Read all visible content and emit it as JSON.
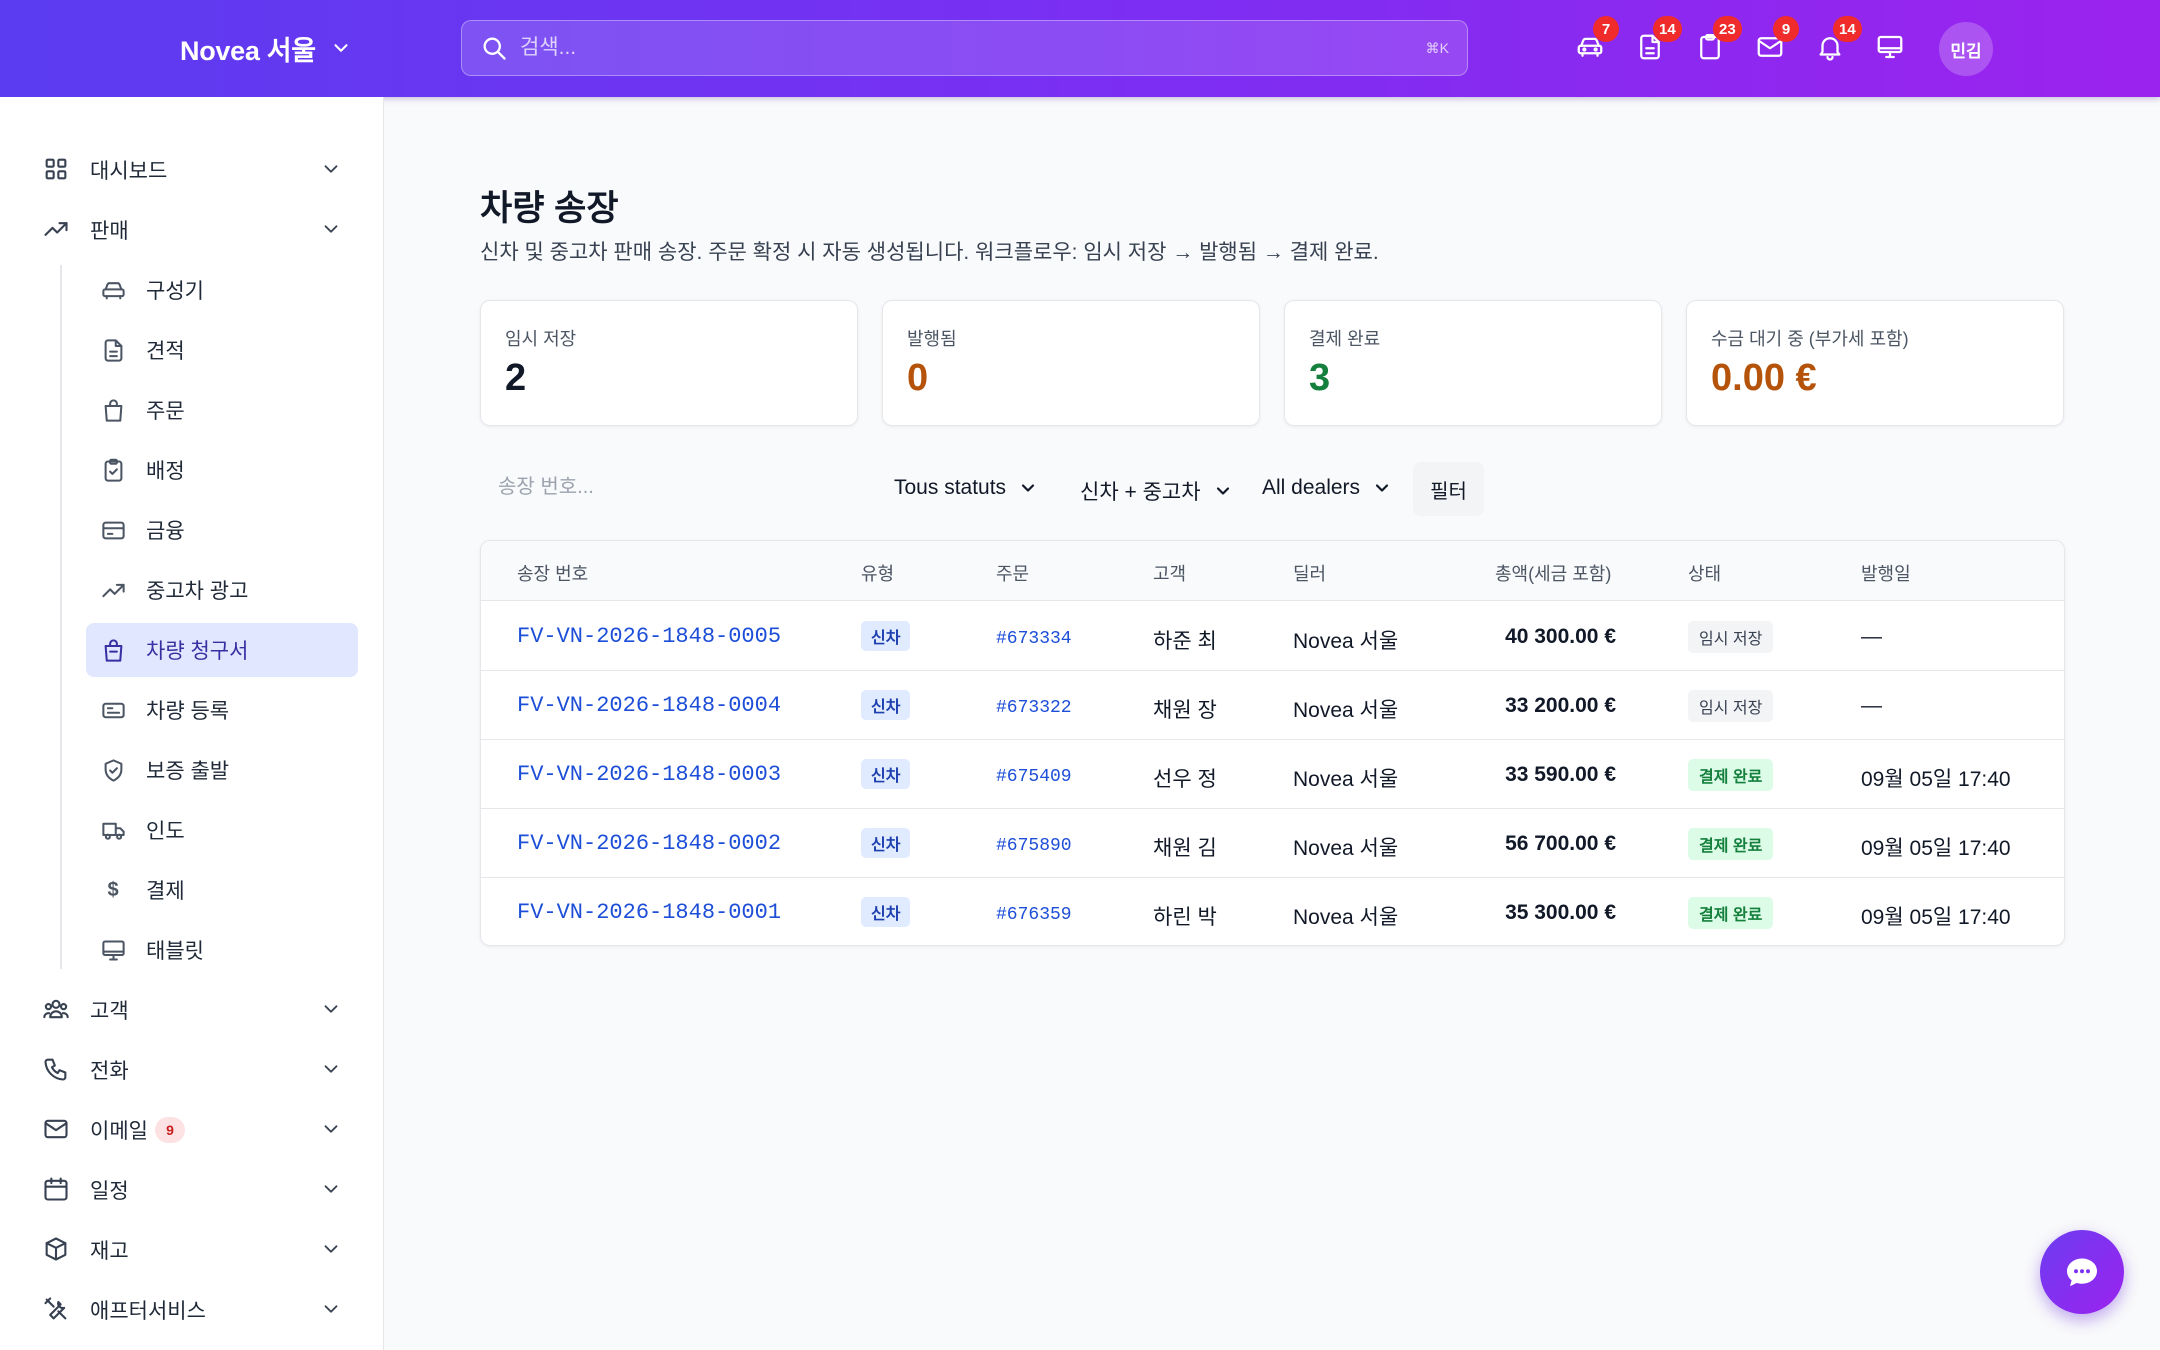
{
  "header": {
    "brand": "Novea 서울",
    "search_placeholder": "검색...",
    "shortcut": "⌘K",
    "badges": {
      "car": "7",
      "document": "14",
      "clipboard": "23",
      "mail": "9",
      "bell": "14"
    },
    "avatar": "민김"
  },
  "sidebar": {
    "dashboard": "대시보드",
    "sales": "판매",
    "sub_items": [
      "구성기",
      "견적",
      "주문",
      "배정",
      "금융",
      "중고차 광고",
      "차량 청구서",
      "차량 등록",
      "보증 출발",
      "인도",
      "결제",
      "태블릿"
    ],
    "customers": "고객",
    "phone": "전화",
    "email": "이메일",
    "email_badge": "9",
    "calendar": "일정",
    "stock": "재고",
    "aftersales": "애프터서비스"
  },
  "page": {
    "title": "차량 송장",
    "subtitle": "신차 및 중고차 판매 송장. 주문 확정 시 자동 생성됩니다. 워크플로우: 임시 저장 → 발행됨 → 결제 완료."
  },
  "stats": [
    {
      "label": "임시 저장",
      "value": "2",
      "color": "#111827"
    },
    {
      "label": "발행됨",
      "value": "0",
      "color": "#b45309"
    },
    {
      "label": "결제 완료",
      "value": "3",
      "color": "#15803d"
    },
    {
      "label": "수금 대기 중 (부가세 포함)",
      "value": "0.00 €",
      "color": "#b45309"
    }
  ],
  "filters": {
    "invoice_placeholder": "송장 번호...",
    "status": "Tous statuts",
    "kind": "신차 + 중고차",
    "dealer": "All dealers",
    "filter_button": "필터"
  },
  "table": {
    "headers": [
      "송장 번호",
      "유형",
      "주문",
      "고객",
      "딜러",
      "총액(세금 포함)",
      "상태",
      "발행일"
    ],
    "rows": [
      {
        "invoice": "FV-VN-2026-1848-0005",
        "type": "신차",
        "order": "#673334",
        "customer": "하준 최",
        "dealer": "Novea 서울",
        "amount": "40 300.00 €",
        "status": "임시 저장",
        "date": "—"
      },
      {
        "invoice": "FV-VN-2026-1848-0004",
        "type": "신차",
        "order": "#673322",
        "customer": "채원 장",
        "dealer": "Novea 서울",
        "amount": "33 200.00 €",
        "status": "임시 저장",
        "date": "—"
      },
      {
        "invoice": "FV-VN-2026-1848-0003",
        "type": "신차",
        "order": "#675409",
        "customer": "선우 정",
        "dealer": "Novea 서울",
        "amount": "33 590.00 €",
        "status": "결제 완료",
        "date": "09월 05일 17:40"
      },
      {
        "invoice": "FV-VN-2026-1848-0002",
        "type": "신차",
        "order": "#675890",
        "customer": "채원 김",
        "dealer": "Novea 서울",
        "amount": "56 700.00 €",
        "status": "결제 완료",
        "date": "09월 05일 17:40"
      },
      {
        "invoice": "FV-VN-2026-1848-0001",
        "type": "신차",
        "order": "#676359",
        "customer": "하린 박",
        "dealer": "Novea 서울",
        "amount": "35 300.00 €",
        "status": "결제 완료",
        "date": "09월 05일 17:40"
      }
    ]
  }
}
